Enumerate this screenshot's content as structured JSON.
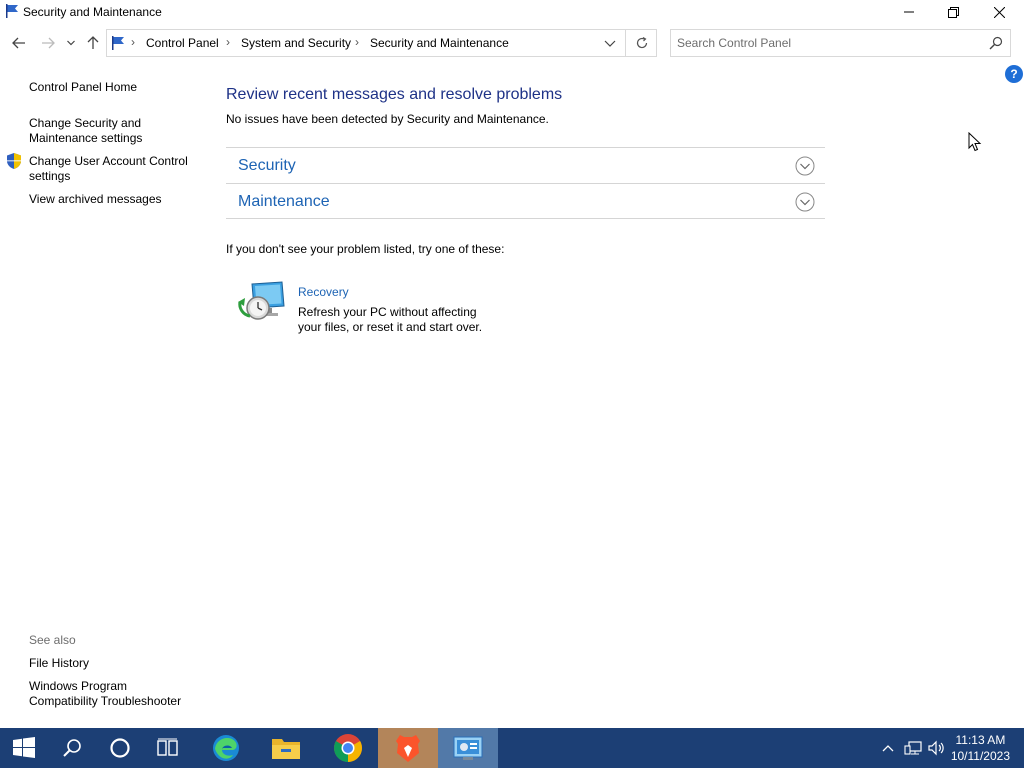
{
  "window": {
    "title": "Security and Maintenance"
  },
  "address": {
    "breadcrumbs": [
      "Control Panel",
      "System and Security",
      "Security and Maintenance"
    ]
  },
  "search": {
    "placeholder": "Search Control Panel"
  },
  "help": {
    "label": "?"
  },
  "sidebar": {
    "links": [
      "Control Panel Home",
      "Change Security and Maintenance settings",
      "Change User Account Control settings",
      "View archived messages"
    ],
    "see_also_label": "See also",
    "see_also": [
      "File History",
      "Windows Program Compatibility Troubleshooter"
    ]
  },
  "main": {
    "heading": "Review recent messages and resolve problems",
    "status": "No issues have been detected by Security and Maintenance.",
    "sections": [
      "Security",
      "Maintenance"
    ],
    "try_text": "If you don't see your problem listed, try one of these:",
    "recovery": {
      "title": "Recovery",
      "description": "Refresh your PC without affecting your files, or reset it and start over."
    }
  },
  "taskbar": {
    "apps": [
      "start-icon",
      "search-icon",
      "cortana-icon",
      "task-view-icon",
      "edge-icon",
      "file-explorer-icon",
      "chrome-icon",
      "brave-icon",
      "control-panel-icon"
    ],
    "time": "11:13 AM",
    "date": "10/11/2023"
  },
  "colors": {
    "heading": "#1e3287",
    "link": "#1e64b4",
    "taskbar": "#1c3f75"
  }
}
